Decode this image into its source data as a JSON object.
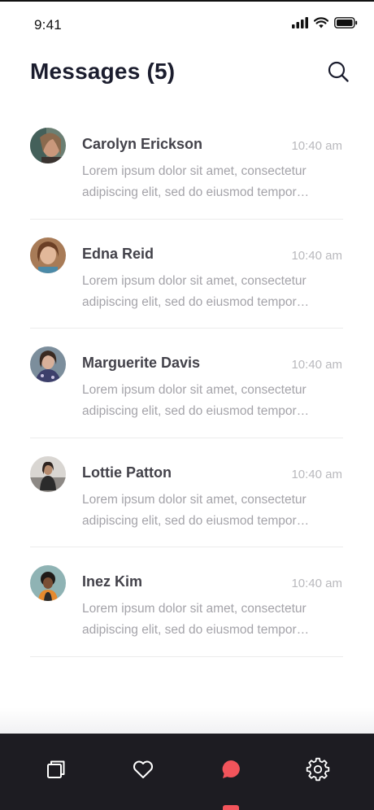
{
  "status_bar": {
    "time": "9:41",
    "icons": [
      "signal-icon",
      "wifi-icon",
      "battery-icon"
    ]
  },
  "header": {
    "title": "Messages (5)",
    "search_icon": "search-icon"
  },
  "messages": [
    {
      "name": "Carolyn Erickson",
      "time": "10:40 am",
      "preview": "Lorem ipsum dolor sit amet, consectetur adipiscing elit, sed do eiusmod tempor incididunt ut labore"
    },
    {
      "name": "Edna Reid",
      "time": "10:40 am",
      "preview": "Lorem ipsum dolor sit amet, consectetur adipiscing elit, sed do eiusmod tempor incididunt ut labore"
    },
    {
      "name": "Marguerite Davis",
      "time": "10:40 am",
      "preview": "Lorem ipsum dolor sit amet, consectetur adipiscing elit, sed do eiusmod tempor incididunt ut labore"
    },
    {
      "name": "Lottie Patton",
      "time": "10:40 am",
      "preview": "Lorem ipsum dolor sit amet, consectetur adipiscing elit, sed do eiusmod tempor incididunt ut labore"
    },
    {
      "name": "Inez Kim",
      "time": "10:40 am",
      "preview": "Lorem ipsum dolor sit amet, consectetur adipiscing elit, sed do eiusmod tempor incididunt ut labore"
    }
  ],
  "tab_bar": {
    "tabs": [
      {
        "icon": "collections-icon",
        "active": false
      },
      {
        "icon": "heart-icon",
        "active": false
      },
      {
        "icon": "chat-bubble-icon",
        "active": true
      },
      {
        "icon": "gear-icon",
        "active": false
      }
    ]
  },
  "colors": {
    "accent": "#f2545b",
    "tab_bar_bg": "#1d1c22",
    "title": "#1b1d2e",
    "name": "#43424a",
    "preview": "#a4a3a9",
    "time": "#b9b9bd"
  }
}
